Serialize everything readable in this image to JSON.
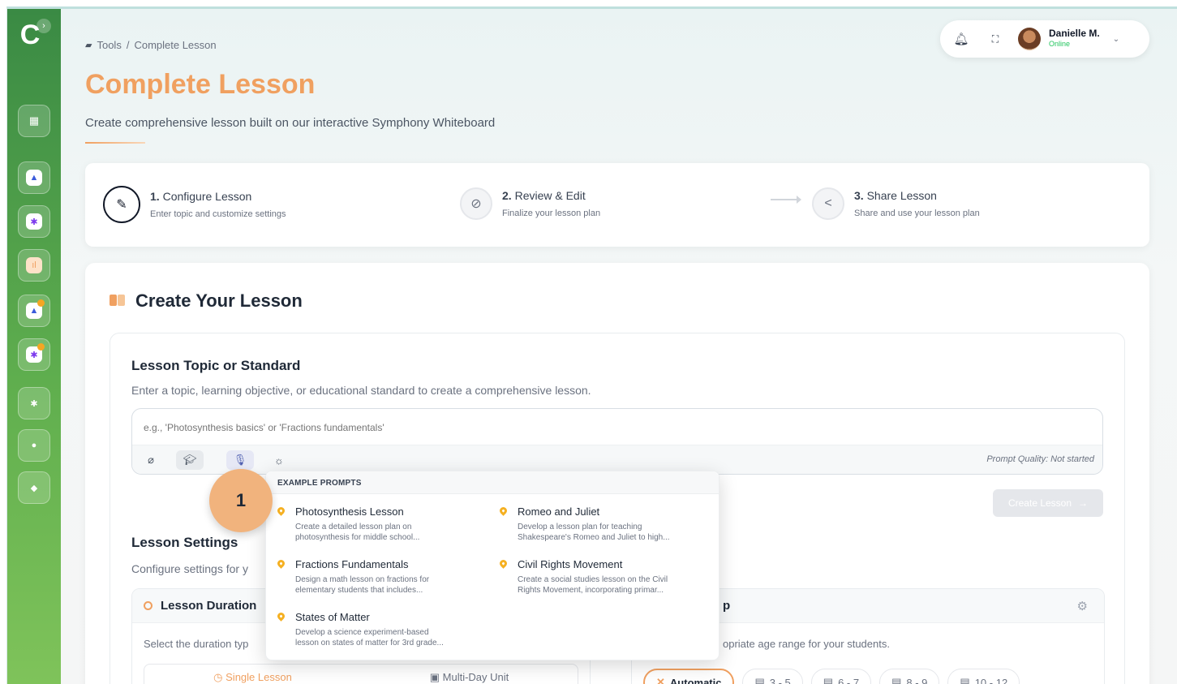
{
  "breadcrumb": {
    "root": "Tools",
    "sep": "/",
    "current": "Complete Lesson"
  },
  "header": {
    "title": "Complete Lesson",
    "subtitle": "Create comprehensive lesson built on our interactive Symphony Whiteboard"
  },
  "user": {
    "name": "Danielle M.",
    "status": "Online"
  },
  "steps": [
    {
      "num": "1.",
      "title": "Configure Lesson",
      "desc": "Enter topic and customize settings"
    },
    {
      "num": "2.",
      "title": "Review & Edit",
      "desc": "Finalize your lesson plan"
    },
    {
      "num": "3.",
      "title": "Share Lesson",
      "desc": "Share and use your lesson plan"
    }
  ],
  "create": {
    "title": "Create Your Lesson",
    "topic_label": "Lesson Topic or Standard",
    "topic_help": "Enter a topic, learning objective, or educational standard to create a comprehensive lesson.",
    "topic_placeholder": "e.g., 'Photosynthesis basics' or 'Fractions fundamentals'",
    "prompt_quality": "Prompt Quality: Not started",
    "create_button": "Create Lesson"
  },
  "settings": {
    "title": "Lesson Settings",
    "help": "Configure settings for y",
    "duration_title": "Lesson Duration",
    "duration_help": "Select the duration typ",
    "single_lesson": "Single Lesson",
    "multi_day": "Multi-Day Unit",
    "age_title": "p",
    "age_help": "opriate age range for your students.",
    "age_options": [
      "Automatic",
      "3 - 5",
      "6 - 7",
      "8 - 9",
      "10 - 12"
    ]
  },
  "dropdown": {
    "header": "EXAMPLE PROMPTS",
    "prompts": [
      {
        "title": "Photosynthesis Lesson",
        "desc1": "Create a detailed lesson plan on",
        "desc2": "photosynthesis for middle school..."
      },
      {
        "title": "Romeo and Juliet",
        "desc1": "Develop a lesson plan for teaching",
        "desc2": "Shakespeare's Romeo and Juliet to high..."
      },
      {
        "title": "Fractions Fundamentals",
        "desc1": "Design a math lesson on fractions for",
        "desc2": "elementary students that includes..."
      },
      {
        "title": "Civil Rights Movement",
        "desc1": "Create a social studies lesson on the Civil",
        "desc2": "Rights Movement, incorporating primar..."
      },
      {
        "title": "States of Matter",
        "desc1": "Develop a science experiment-based",
        "desc2": "lesson on states of matter for 3rd grade..."
      }
    ]
  },
  "annotation_badge": "1",
  "colors": {
    "accent": "#f0a060",
    "sidebar": "#4f9e48",
    "pin": "#f5b021"
  }
}
